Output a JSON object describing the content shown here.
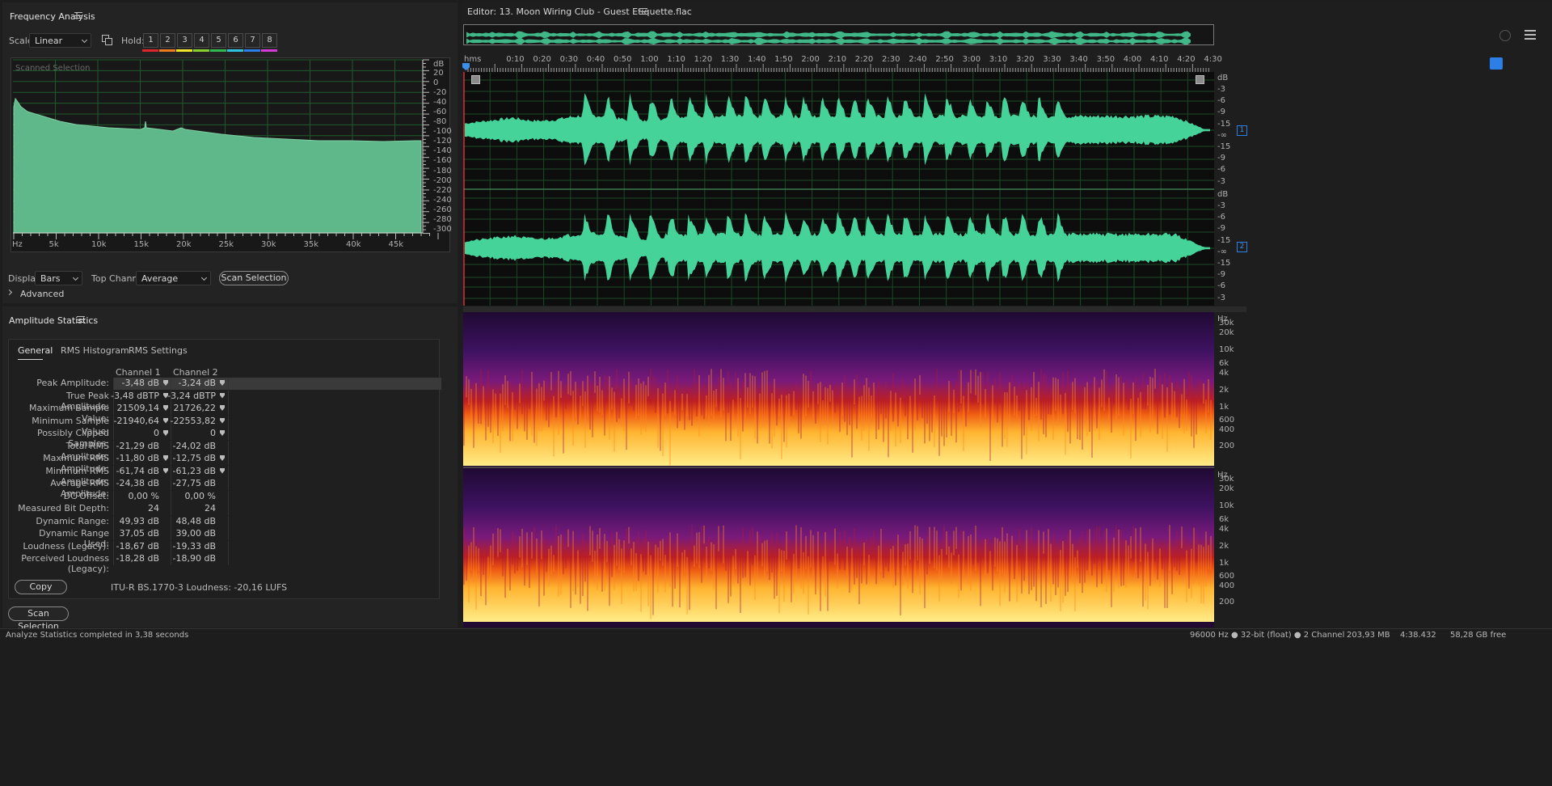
{
  "frequency_analysis": {
    "title": "Frequency Analysis",
    "scale_label": "Scale:",
    "scale_value": "Linear",
    "hold_label": "Hold:",
    "hold_buttons": [
      "1",
      "2",
      "3",
      "4",
      "5",
      "6",
      "7",
      "8"
    ],
    "hold_colors": [
      "#e0262a",
      "#f07b1c",
      "#efe626",
      "#86d12b",
      "#32b94f",
      "#2fc3e6",
      "#2d7fe8",
      "#d43bd6"
    ],
    "graph_caption": "Scanned Selection",
    "db_unit": "dB",
    "db_ticks": [
      "20",
      "0",
      "-20",
      "-40",
      "-60",
      "-80",
      "-100",
      "-120",
      "-140",
      "-160",
      "-180",
      "-200",
      "-220",
      "-240",
      "-260",
      "-280",
      "-300"
    ],
    "hz_ticks": [
      "Hz",
      "5k",
      "10k",
      "15k",
      "20k",
      "25k",
      "30k",
      "35k",
      "40k",
      "45k"
    ],
    "display_label": "Display:",
    "display_value": "Bars",
    "top_channel_label": "Top Channel:",
    "top_channel_value": "Average",
    "scan_button": "Scan Selection",
    "advanced_label": "Advanced",
    "fill_color": "#5fb88a"
  },
  "amplitude_statistics": {
    "title": "Amplitude Statistics",
    "tabs": [
      "General",
      "RMS Histogram",
      "RMS Settings"
    ],
    "active_tab": "General",
    "col_headers": [
      "Channel 1",
      "Channel 2"
    ],
    "rows": [
      {
        "label": "Peak Amplitude:",
        "ch1": "-3,48 dB",
        "ch2": "-3,24 dB",
        "nav": true
      },
      {
        "label": "True Peak Amplitude:",
        "ch1": "-3,48 dBTP",
        "ch2": "-3,24 dBTP",
        "nav": true
      },
      {
        "label": "Maximum Sample Value:",
        "ch1": "21509,14",
        "ch2": "21726,22",
        "nav": true
      },
      {
        "label": "Minimum Sample Value:",
        "ch1": "-21940,64",
        "ch2": "-22553,82",
        "nav": true
      },
      {
        "label": "Possibly Clipped Samples:",
        "ch1": "0",
        "ch2": "0",
        "nav": true
      },
      {
        "label": "Total RMS Amplitude:",
        "ch1": "-21,29 dB",
        "ch2": "-24,02 dB",
        "nav": false
      },
      {
        "label": "Maximum RMS Amplitude:",
        "ch1": "-11,80 dB",
        "ch2": "-12,75 dB",
        "nav": true
      },
      {
        "label": "Minimum RMS Amplitude:",
        "ch1": "-61,74 dB",
        "ch2": "-61,23 dB",
        "nav": true
      },
      {
        "label": "Average RMS Amplitude:",
        "ch1": "-24,38 dB",
        "ch2": "-27,75 dB",
        "nav": false
      },
      {
        "label": "DC Offset:",
        "ch1": "0,00 %",
        "ch2": "0,00 %",
        "nav": false
      },
      {
        "label": "Measured Bit Depth:",
        "ch1": "24",
        "ch2": "24",
        "nav": false
      },
      {
        "label": "Dynamic Range:",
        "ch1": "49,93 dB",
        "ch2": "48,48 dB",
        "nav": false
      },
      {
        "label": "Dynamic Range Used:",
        "ch1": "37,05 dB",
        "ch2": "39,00 dB",
        "nav": false
      },
      {
        "label": "Loudness (Legacy):",
        "ch1": "-18,67 dB",
        "ch2": "-19,33 dB",
        "nav": false
      },
      {
        "label": "Perceived Loudness (Legacy):",
        "ch1": "-18,28 dB",
        "ch2": "-18,90 dB",
        "nav": false
      }
    ],
    "copy_button": "Copy",
    "loudness_text": "ITU-R BS.1770-3 Loudness: -20,16 LUFS",
    "scan_button": "Scan Selection"
  },
  "editor": {
    "title": "Editor: 13. Moon Wiring Club - Guest Etiquette.flac",
    "time_ticks": [
      "hms",
      "0:10",
      "0:20",
      "0:30",
      "0:40",
      "0:50",
      "1:00",
      "1:10",
      "1:20",
      "1:30",
      "1:40",
      "1:50",
      "2:00",
      "2:10",
      "2:20",
      "2:30",
      "2:40",
      "2:50",
      "3:00",
      "3:10",
      "3:20",
      "3:30",
      "3:40",
      "3:50",
      "4:00",
      "4:10",
      "4:20",
      "4:30"
    ],
    "db_unit": "dB",
    "wave_db_ticks": [
      "-3",
      "-6",
      "-9",
      "-15",
      "-∞",
      "-15",
      "-9",
      "-6",
      "-3"
    ],
    "channel_badges": [
      "1",
      "2"
    ],
    "hz_unit": "Hz",
    "spec_ticks": [
      "30k",
      "20k",
      "10k",
      "6k",
      "4k",
      "2k",
      "1k",
      "600",
      "400",
      "200"
    ],
    "wave_color": "#46d39a"
  },
  "status_bar": {
    "message": "Analyze Statistics completed in 3,38 seconds",
    "format": "96000 Hz ● 32-bit (float) ● 2 Channel",
    "size": "203,93 MB",
    "duration": "4:38.432",
    "free": "58,28 GB free"
  }
}
